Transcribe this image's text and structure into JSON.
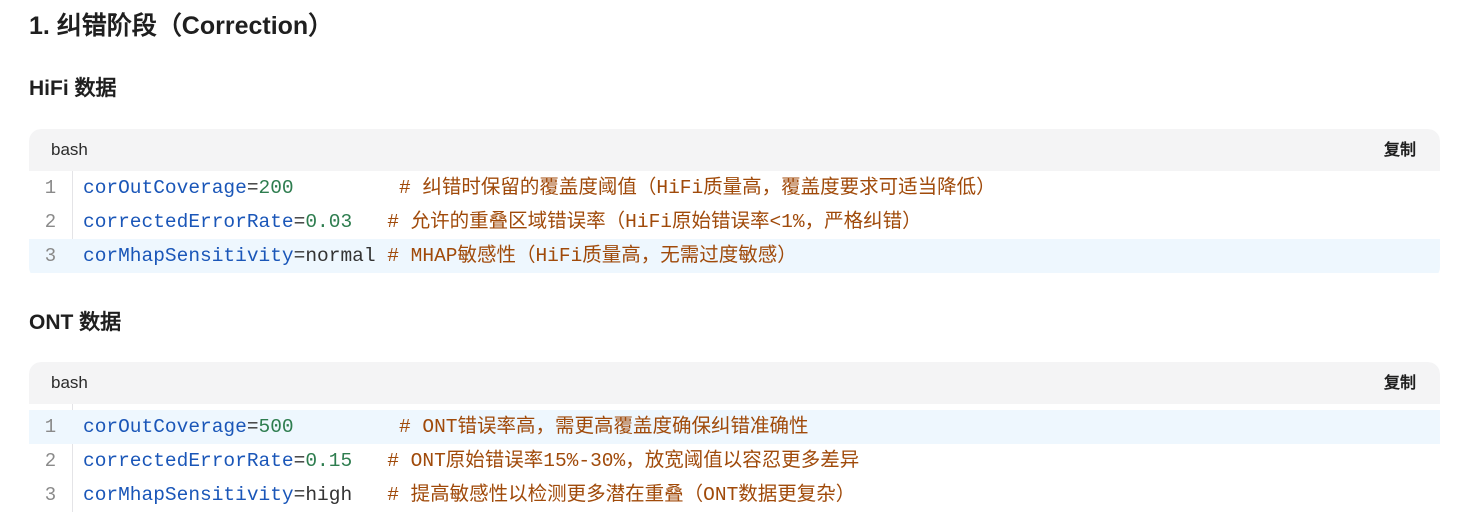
{
  "section_title": "1. 纠错阶段（Correction）",
  "hifi": {
    "heading": "HiFi 数据",
    "lang": "bash",
    "copy_label": "复制",
    "lines": [
      {
        "num": "1",
        "key": "corOutCoverage",
        "eq": "=",
        "value": "200",
        "pad": "         ",
        "comment": "# 纠错时保留的覆盖度阈值（HiFi质量高，覆盖度要求可适当降低）"
      },
      {
        "num": "2",
        "key": "correctedErrorRate",
        "eq": "=",
        "value": "0.03",
        "pad": "   ",
        "comment": "# 允许的重叠区域错误率（HiFi原始错误率<1%，严格纠错）"
      },
      {
        "num": "3",
        "key": "corMhapSensitivity",
        "eq": "=",
        "value": "normal",
        "pad": " ",
        "comment": "# MHAP敏感性（HiFi质量高，无需过度敏感）"
      }
    ]
  },
  "ont": {
    "heading": "ONT 数据",
    "lang": "bash",
    "copy_label": "复制",
    "lines": [
      {
        "num": "1",
        "key": "corOutCoverage",
        "eq": "=",
        "value": "500",
        "pad": "         ",
        "comment": "# ONT错误率高，需更高覆盖度确保纠错准确性"
      },
      {
        "num": "2",
        "key": "correctedErrorRate",
        "eq": "=",
        "value": "0.15",
        "pad": "   ",
        "comment": "# ONT原始错误率15%-30%，放宽阈值以容忍更多差异"
      },
      {
        "num": "3",
        "key": "corMhapSensitivity",
        "eq": "=",
        "value": "high",
        "pad": "   ",
        "comment": "# 提高敏感性以检测更多潜在重叠（ONT数据更复杂）"
      }
    ]
  },
  "colors": {
    "key": "#1a56b8",
    "number": "#2e7d4f",
    "comment": "#a04a0a",
    "highlight": "#eef7fe",
    "header_bg": "#f4f4f5"
  }
}
